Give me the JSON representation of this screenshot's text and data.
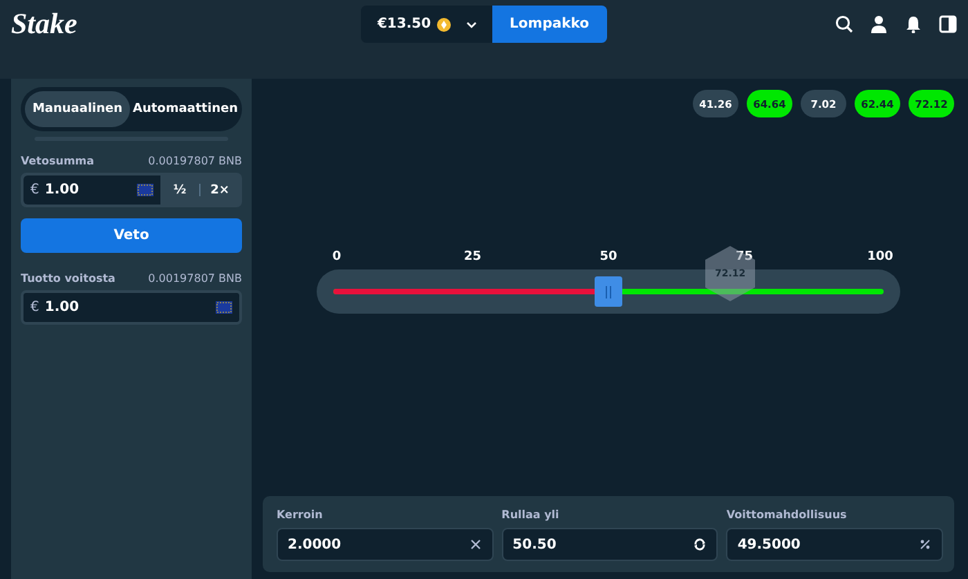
{
  "header": {
    "logo": "Stake",
    "balance": "€13.50",
    "wallet_button": "Lompakko"
  },
  "sidebar": {
    "tabs": [
      {
        "label": "Manuaalinen",
        "selected": true
      },
      {
        "label": "Automaattinen",
        "selected": false
      }
    ],
    "bet_amount": {
      "label": "Vetosumma",
      "crypto": "0.00197807 BNB",
      "currency": "€",
      "value": "1.00",
      "half": "½",
      "double": "2×"
    },
    "bet_button": "Veto",
    "profit": {
      "label": "Tuotto voitosta",
      "crypto": "0.00197807 BNB",
      "currency": "€",
      "value": "1.00"
    }
  },
  "results": [
    {
      "value": "41.26",
      "win": false
    },
    {
      "value": "64.64",
      "win": true
    },
    {
      "value": "7.02",
      "win": false
    },
    {
      "value": "62.44",
      "win": true
    },
    {
      "value": "72.12",
      "win": true
    }
  ],
  "slider": {
    "ticks": [
      "0",
      "25",
      "50",
      "75",
      "100"
    ],
    "level": 0.5,
    "result": "72.12"
  },
  "fields": [
    {
      "label": "Kerroin",
      "value": "2.0000",
      "kind": "multiplier"
    },
    {
      "label": "Rullaa yli",
      "value": "50.50",
      "kind": "swap"
    },
    {
      "label": "Voittomahdollisuus",
      "value": "49.5000",
      "kind": "percent"
    }
  ]
}
